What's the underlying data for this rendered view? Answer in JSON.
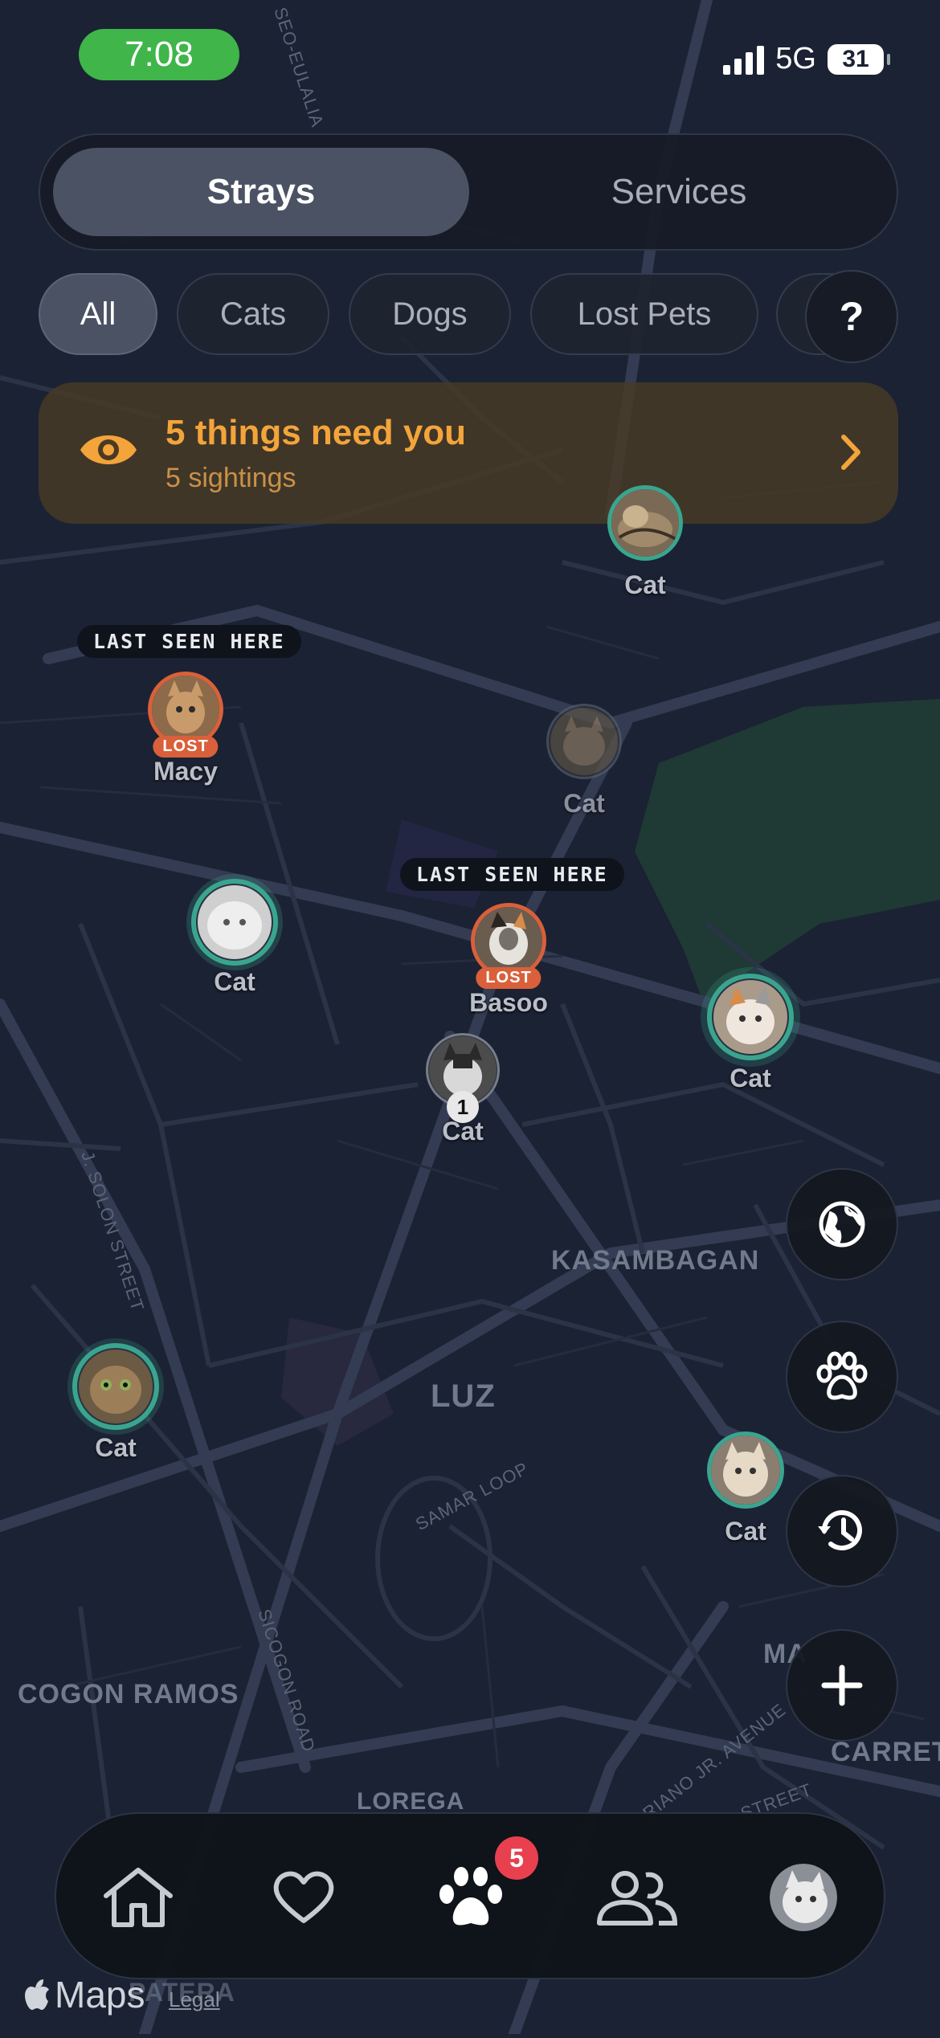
{
  "status_bar": {
    "time": "7:08",
    "network": "5G",
    "battery": "31"
  },
  "segment": {
    "active": "Strays",
    "inactive": "Services"
  },
  "chips": [
    "All",
    "Cats",
    "Dogs",
    "Lost Pets"
  ],
  "help_label": "?",
  "alert": {
    "title": "5 things need you",
    "subtitle": "5 sightings"
  },
  "map": {
    "area_labels": [
      "KASAMBAGAN",
      "LUZ",
      "COGON RAMOS",
      "LOREGA",
      "CARRETA",
      "PATERA",
      "MA"
    ],
    "street_labels": [
      "J. SOLON STREET",
      "SAMAR LOOP",
      "SICOGON ROAD",
      "SEO-EULALIA",
      "RIANO JR. AVENUE",
      "STREET"
    ]
  },
  "pins": [
    {
      "label": "Cat",
      "kind": "stray"
    },
    {
      "label": "Macy",
      "kind": "lost",
      "badge": "LOST",
      "callout": "LAST SEEN HERE"
    },
    {
      "label": "Cat",
      "kind": "stray-faded"
    },
    {
      "label": "Cat",
      "kind": "stray"
    },
    {
      "label": "Basoo",
      "kind": "lost",
      "badge": "LOST",
      "callout": "LAST SEEN HERE"
    },
    {
      "label": "Cat",
      "kind": "cluster",
      "count": "1"
    },
    {
      "label": "Cat",
      "kind": "stray"
    },
    {
      "label": "Cat",
      "kind": "stray"
    },
    {
      "label": "Cat",
      "kind": "stray"
    }
  ],
  "fabs": [
    "globe-icon",
    "paw-icon",
    "history-icon",
    "plus-icon"
  ],
  "tabbar": {
    "items": [
      "home-icon",
      "heart-icon",
      "paw-icon",
      "people-icon",
      "profile-avatar"
    ],
    "badge": "5"
  },
  "footer": {
    "maps": "Maps",
    "legal": "Legal"
  },
  "colors": {
    "accent_orange": "#f3a43a",
    "lost_badge": "#d9603a",
    "stray_ring": "#3aa58f",
    "badge_red": "#e8404f"
  }
}
